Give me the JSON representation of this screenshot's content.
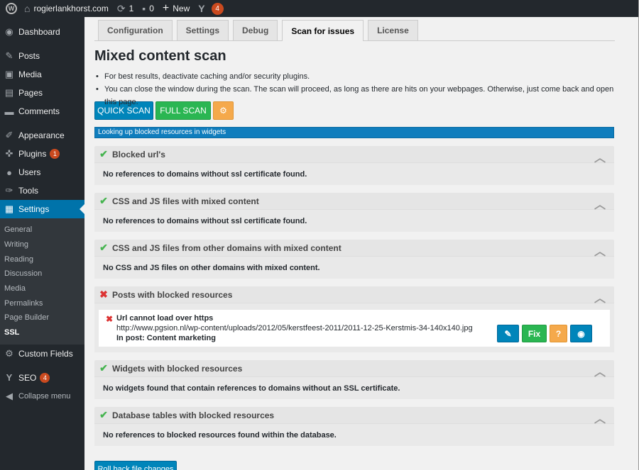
{
  "adminbar": {
    "site_name": "rogierlankhorst.com",
    "updates_count": "1",
    "comments_count": "0",
    "new_label": "New",
    "seo_count": "4"
  },
  "sidebar": {
    "items": [
      {
        "label": "Dashboard",
        "icon": "dashboard-icon"
      },
      {
        "label": "Posts",
        "icon": "pin-icon"
      },
      {
        "label": "Media",
        "icon": "media-icon"
      },
      {
        "label": "Pages",
        "icon": "pages-icon"
      },
      {
        "label": "Comments",
        "icon": "comment-icon"
      },
      {
        "label": "Appearance",
        "icon": "brush-icon"
      },
      {
        "label": "Plugins",
        "icon": "plug-icon",
        "badge": "1"
      },
      {
        "label": "Users",
        "icon": "user-icon"
      },
      {
        "label": "Tools",
        "icon": "wrench-icon"
      },
      {
        "label": "Settings",
        "icon": "settings-icon"
      }
    ],
    "submenu": [
      "General",
      "Writing",
      "Reading",
      "Discussion",
      "Media",
      "Permalinks",
      "Page Builder",
      "SSL"
    ],
    "after": [
      {
        "label": "Custom Fields",
        "icon": "gear-icon"
      },
      {
        "label": "SEO",
        "icon": "seo-icon",
        "badge": "4"
      },
      {
        "label": "Collapse menu",
        "icon": "collapse-icon"
      }
    ]
  },
  "tabs": [
    "Configuration",
    "Settings",
    "Debug",
    "Scan for issues",
    "License"
  ],
  "page": {
    "title": "Mixed content scan",
    "bullets": [
      "For best results, deactivate caching and/or security plugins.",
      "You can close the window during the scan. The scan will proceed, as long as there are hits on your webpages. Otherwise, just come back and open this page."
    ],
    "quick_scan": "QUICK SCAN",
    "full_scan": "FULL SCAN",
    "progress_text": "Looking up blocked resources in widgets"
  },
  "panels": [
    {
      "title": "Blocked url's",
      "status": "ok",
      "body": "No references to domains without ssl certificate found."
    },
    {
      "title": "CSS and JS files with mixed content",
      "status": "ok",
      "body": "No references to domains without ssl certificate found."
    },
    {
      "title": "CSS and JS files from other domains with mixed content",
      "status": "ok",
      "body": "No CSS and JS files on other domains with mixed content."
    },
    {
      "title": "Posts with blocked resources",
      "status": "error",
      "body": ""
    },
    {
      "title": "Widgets with blocked resources",
      "status": "ok",
      "body": "No widgets found that contain references to domains without an SSL certificate."
    },
    {
      "title": "Database tables with blocked resources",
      "status": "ok",
      "body": "No references to blocked resources found within the database."
    }
  ],
  "issue": {
    "heading": "Url cannot load over https",
    "url": "http://www.pgsion.nl/wp-content/uploads/2012/05/kerstfeest-2011/2011-12-25-Kerstmis-34-140x140.jpg",
    "in_post": "In post: Content marketing",
    "fix_label": "Fix",
    "help_label": "?"
  },
  "rollback_label": "Roll back file changes",
  "colors": {
    "adminbar": "#23282d",
    "accent_blue": "#0085ba",
    "success_green": "#2ab652",
    "warning_orange": "#f5a94b",
    "error_red": "#dc3232"
  }
}
